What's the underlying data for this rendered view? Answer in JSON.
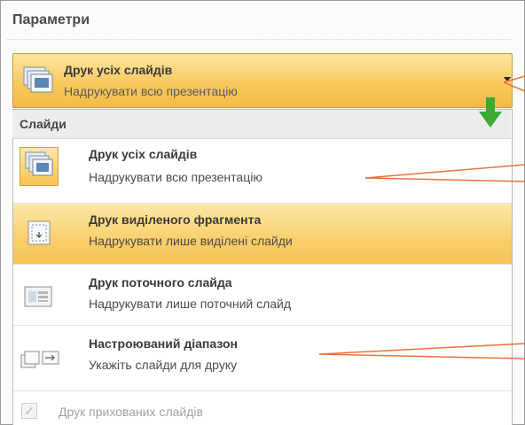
{
  "panel": {
    "title": "Параметри"
  },
  "selector": {
    "title": "Друк усіх слайдів",
    "description": "Надрукувати всю презентацію",
    "icon": "all-slides-icon"
  },
  "dropdown": {
    "group_label": "Слайди",
    "items": [
      {
        "title": "Друк усіх слайдів",
        "description": "Надрукувати всю презентацію",
        "icon": "all-slides-icon"
      },
      {
        "title": "Друк виділеного фрагмента",
        "description": "Надрукувати лише виділені слайди",
        "icon": "selection-icon"
      },
      {
        "title": "Друк поточного слайда",
        "description": "Надрукувати лише поточний слайд",
        "icon": "current-slide-icon"
      },
      {
        "title": "Настроюваний діапазон",
        "description": "Укажіть слайди для друку",
        "icon": "custom-range-icon"
      }
    ],
    "hidden_slides_label": "Друк прихованих слайдів"
  },
  "colors": {
    "highlight": "#f9cf6b",
    "selector_border": "#c59a3e",
    "callout": "#e8743b",
    "arrow": "#3aaa35"
  }
}
